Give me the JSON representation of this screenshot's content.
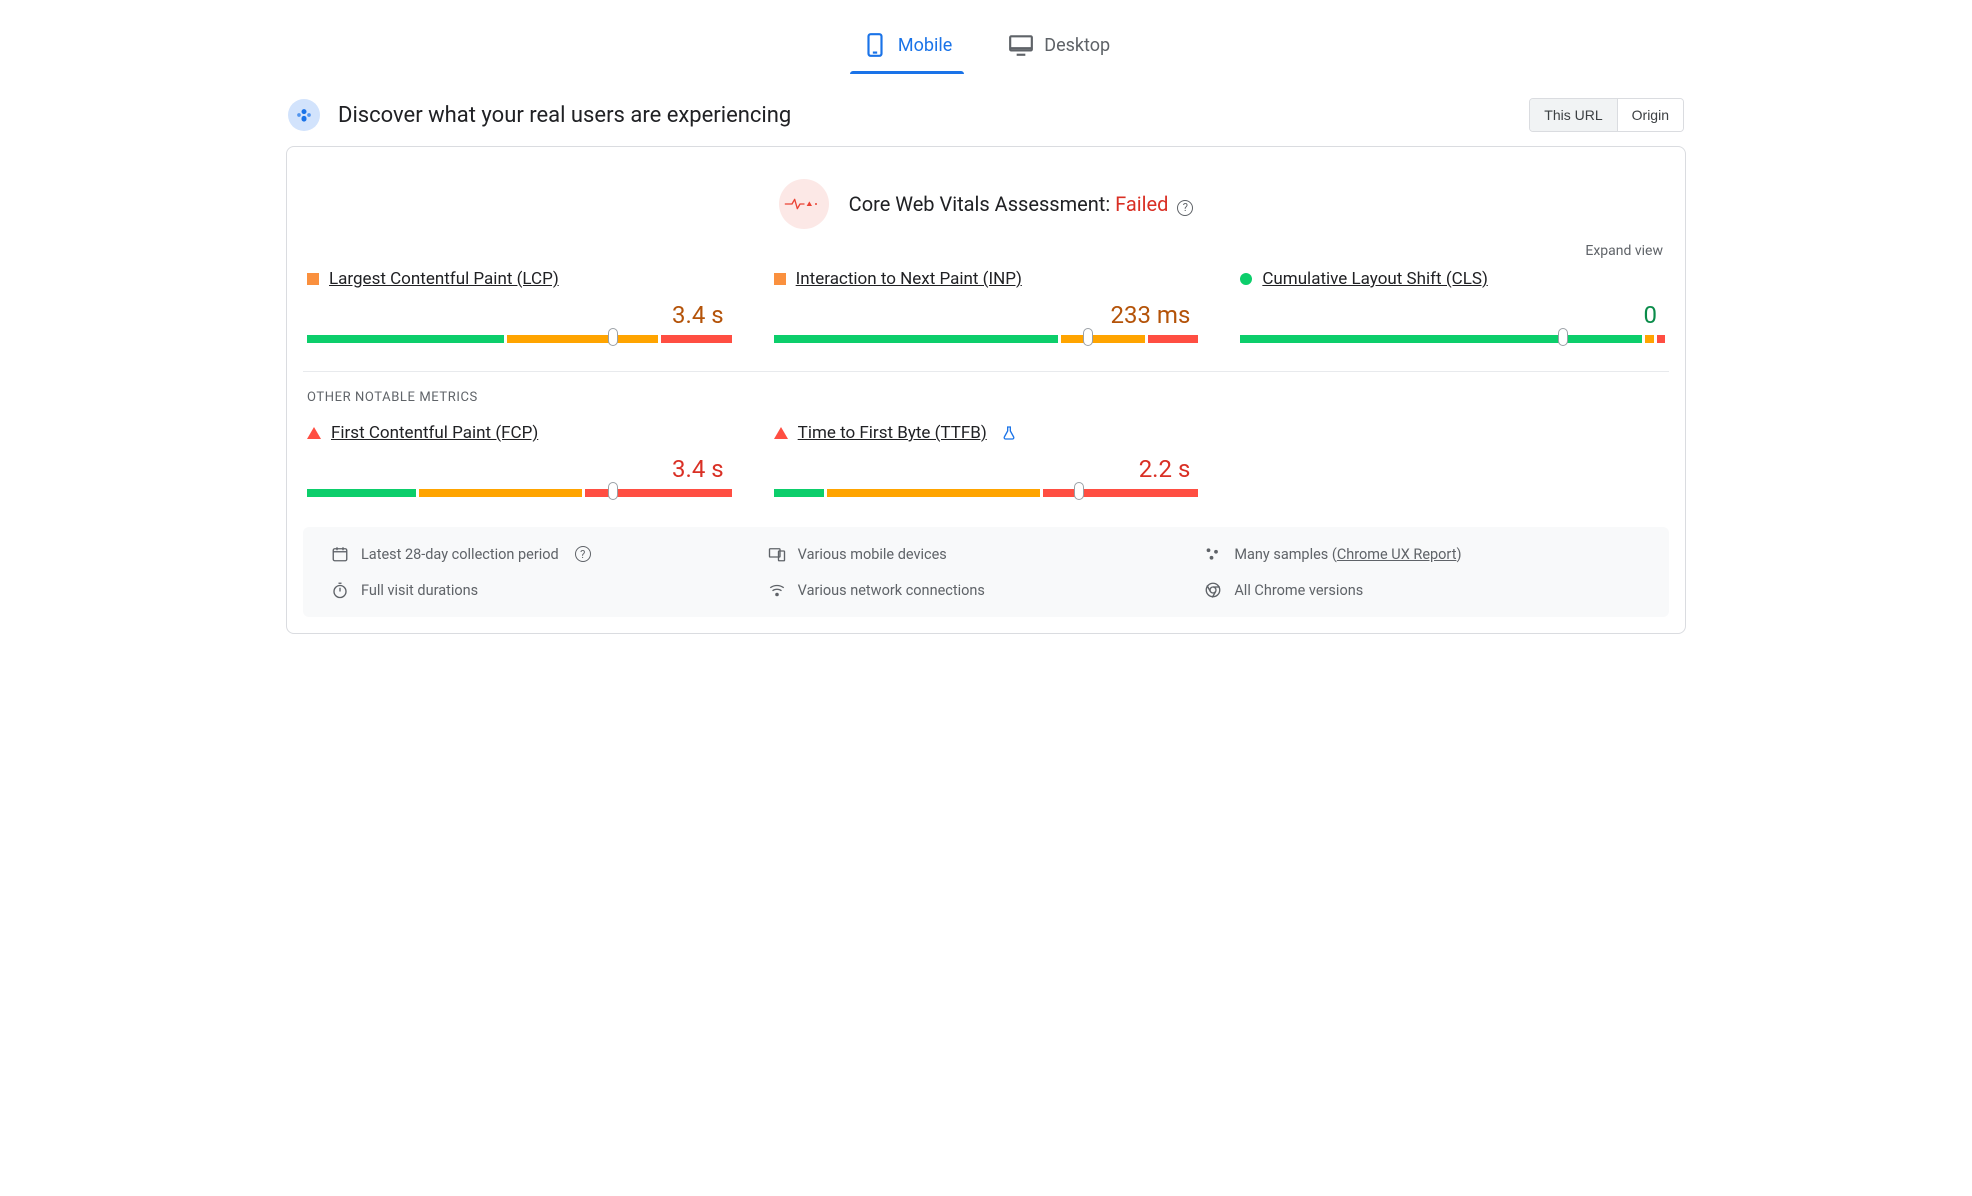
{
  "tabs": {
    "mobile": "Mobile",
    "desktop": "Desktop"
  },
  "header": {
    "title": "Discover what your real users are experiencing",
    "seg_this_url": "This URL",
    "seg_origin": "Origin"
  },
  "assessment": {
    "label": "Core Web Vitals Assessment: ",
    "status": "Failed"
  },
  "expand_view": "Expand view",
  "core_metrics": {
    "lcp": {
      "name": "Largest Contentful Paint (LCP)",
      "value": "3.4 s",
      "status": "orange",
      "bar": {
        "g": 47,
        "o": 36,
        "r": 17,
        "marker": 72
      }
    },
    "inp": {
      "name": "Interaction to Next Paint (INP)",
      "value": "233 ms",
      "status": "orange",
      "bar": {
        "g": 68,
        "o": 20,
        "r": 12,
        "marker": 74
      }
    },
    "cls": {
      "name": "Cumulative Layout Shift (CLS)",
      "value": "0",
      "status": "green",
      "bar": {
        "g": 96,
        "o": 2,
        "r": 2,
        "marker": 76
      }
    }
  },
  "other_label": "OTHER NOTABLE METRICS",
  "other_metrics": {
    "fcp": {
      "name": "First Contentful Paint (FCP)",
      "value": "3.4 s",
      "status": "red",
      "bar": {
        "g": 26,
        "o": 39,
        "r": 35,
        "marker": 72
      }
    },
    "ttfb": {
      "name": "Time to First Byte (TTFB)",
      "value": "2.2 s",
      "status": "red",
      "bar": {
        "g": 12,
        "o": 51,
        "r": 37,
        "marker": 72
      }
    }
  },
  "footer": {
    "period": "Latest 28-day collection period",
    "devices": "Various mobile devices",
    "samples_prefix": "Many samples (",
    "samples_link": "Chrome UX Report",
    "samples_suffix": ")",
    "durations": "Full visit durations",
    "network": "Various network connections",
    "chrome": "All Chrome versions"
  }
}
